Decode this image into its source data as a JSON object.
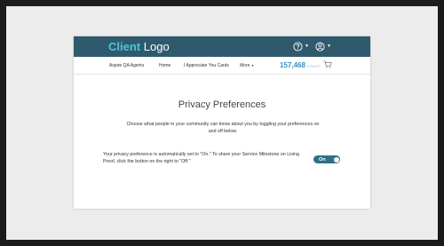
{
  "header": {
    "logo_primary": "Client",
    "logo_secondary": "Logo",
    "brand_color": "#2f5a6e",
    "accent_color": "#4cc3d9",
    "help_icon": "help-circle-icon",
    "user_icon": "user-circle-icon"
  },
  "nav": {
    "items": [
      {
        "label": "Aspire QA Agents"
      },
      {
        "label": "Home"
      },
      {
        "label": "I Appreciate You Cards"
      },
      {
        "label": "More",
        "caret": "▾"
      }
    ],
    "points_value": "157,468",
    "points_unit": "POINTS",
    "cart_icon": "shopping-cart-icon"
  },
  "main": {
    "title": "Privacy Preferences",
    "description": "Choose what people in your community can know about you by toggling your preferences on and off below.",
    "notice": "Your privacy preference is automatically set to \"On.\" To share your Service Milestone on Living Proof, click the button on the right to \"Off.\"",
    "toggle_label": "On",
    "toggle_color": "#2f6f87"
  }
}
